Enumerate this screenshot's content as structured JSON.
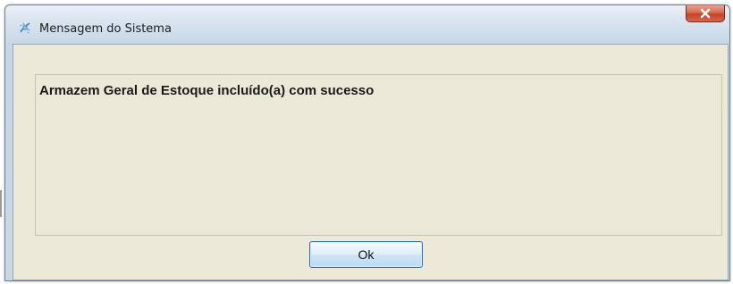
{
  "window": {
    "title": "Mensagem do Sistema",
    "title_icon": "system-message-icon",
    "close_icon": "close-x-icon",
    "close_color": "#c94a30"
  },
  "message": {
    "text": "Armazem Geral de Estoque incluído(a) com sucesso"
  },
  "buttons": {
    "ok_label": "Ok"
  },
  "colors": {
    "client_background": "#ece9d8",
    "frame_blue": "#c9d8e7",
    "ok_border": "#2f6fb0"
  }
}
